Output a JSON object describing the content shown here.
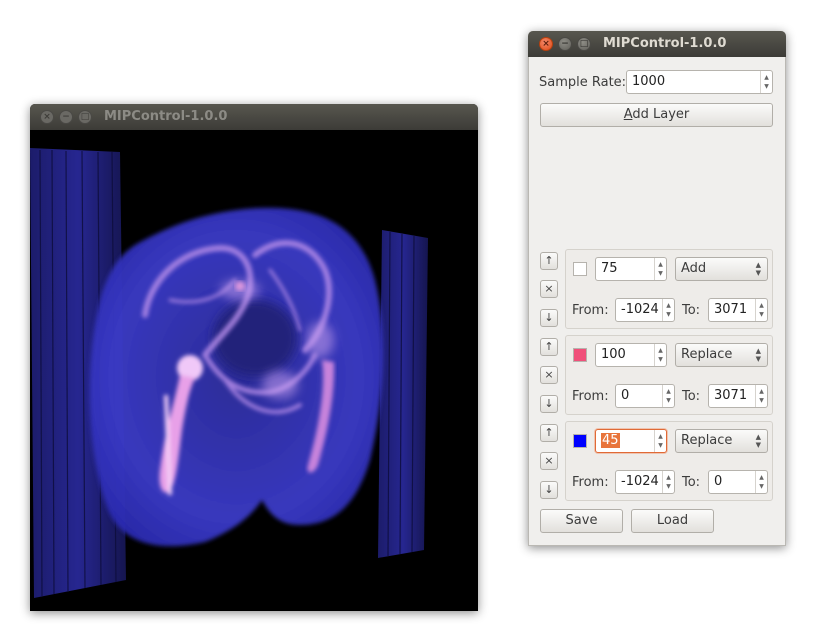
{
  "viewer": {
    "title": "MIPControl-1.0.0",
    "close_glyph": "×",
    "minimize_glyph": "−",
    "maximize_glyph": "□"
  },
  "control": {
    "title": "MIPControl-1.0.0",
    "close_glyph": "×",
    "minimize_glyph": "−",
    "maximize_glyph": "□",
    "sample_rate_label": "Sample Rate:",
    "sample_rate_value": "1000",
    "add_layer_prefix": "A",
    "add_layer_rest": "dd Layer",
    "save_label": "Save",
    "load_label": "Load",
    "spin_up_glyph": "▲",
    "spin_down_glyph": "▼",
    "move_up_glyph": "↑",
    "remove_glyph": "×",
    "move_down_glyph": "↓",
    "from_label": "From:",
    "to_label": "To:"
  },
  "layers": [
    {
      "color": "#ffffff",
      "value": "75",
      "mode": "Add",
      "from": "-1024",
      "to": "3071"
    },
    {
      "color": "#f0507a",
      "value": "100",
      "mode": "Replace",
      "from": "0",
      "to": "3071"
    },
    {
      "color": "#0000ff",
      "value": "45",
      "mode": "Replace",
      "from": "-1024",
      "to": "0"
    }
  ],
  "icons": {
    "close": "close-icon",
    "minimize": "minimize-icon",
    "maximize": "maximize-icon",
    "arrow_up": "arrow-up-icon",
    "arrow_down": "arrow-down-icon",
    "remove": "remove-icon"
  }
}
